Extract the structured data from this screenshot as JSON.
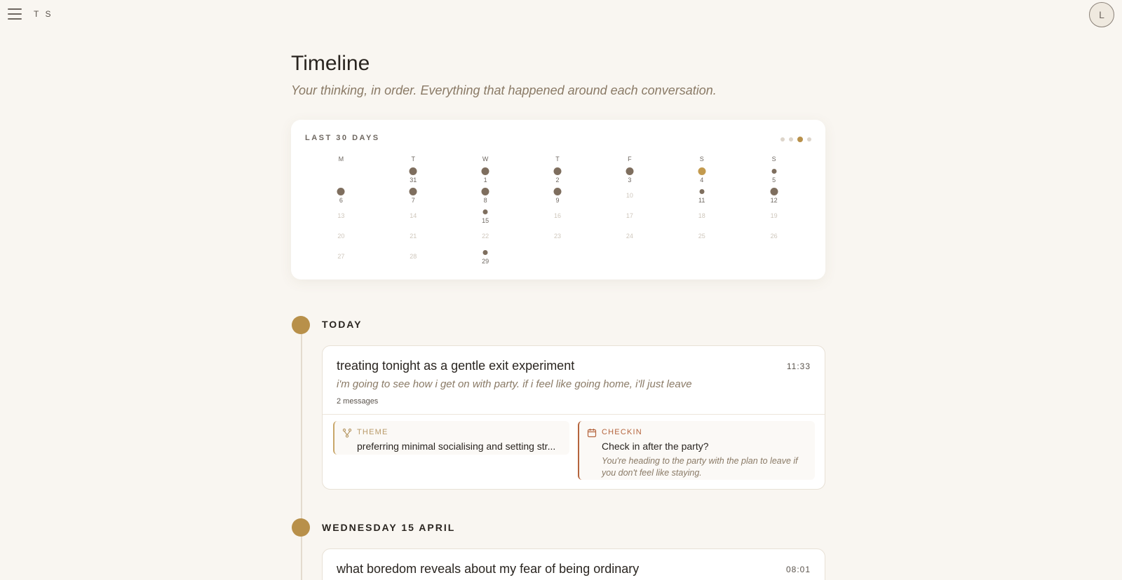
{
  "app": {
    "brand": "T S",
    "avatar_initial": "L"
  },
  "header": {
    "title": "Timeline",
    "subtitle": "Your thinking, in order. Everything that happened around each conversation."
  },
  "calendar": {
    "label": "LAST 30 DAYS",
    "weekdays": [
      "M",
      "T",
      "W",
      "T",
      "F",
      "S",
      "S"
    ],
    "weeks": [
      [
        null,
        {
          "day": "31",
          "dot": "big"
        },
        {
          "day": "1",
          "dot": "big"
        },
        {
          "day": "2",
          "dot": "big"
        },
        {
          "day": "3",
          "dot": "big"
        },
        {
          "day": "4",
          "dot": "gold"
        },
        {
          "day": "5",
          "dot": "small"
        }
      ],
      [
        {
          "day": "6",
          "dot": "big"
        },
        {
          "day": "7",
          "dot": "big"
        },
        {
          "day": "8",
          "dot": "big"
        },
        {
          "day": "9",
          "dot": "big"
        },
        {
          "day": "10",
          "dot": "none"
        },
        {
          "day": "11",
          "dot": "small"
        },
        {
          "day": "12",
          "dot": "big"
        }
      ],
      [
        {
          "day": "13",
          "dot": "none"
        },
        {
          "day": "14",
          "dot": "none"
        },
        {
          "day": "15",
          "dot": "small"
        },
        {
          "day": "16",
          "dot": "none"
        },
        {
          "day": "17",
          "dot": "none"
        },
        {
          "day": "18",
          "dot": "none"
        },
        {
          "day": "19",
          "dot": "none"
        }
      ],
      [
        {
          "day": "20",
          "dot": "none"
        },
        {
          "day": "21",
          "dot": "none"
        },
        {
          "day": "22",
          "dot": "none"
        },
        {
          "day": "23",
          "dot": "none"
        },
        {
          "day": "24",
          "dot": "none"
        },
        {
          "day": "25",
          "dot": "none"
        },
        {
          "day": "26",
          "dot": "none"
        }
      ],
      [
        {
          "day": "27",
          "dot": "none"
        },
        {
          "day": "28",
          "dot": "none"
        },
        {
          "day": "29",
          "dot": "small"
        },
        null,
        null,
        null,
        null
      ]
    ],
    "pager_active_index": 2,
    "pager_count": 4
  },
  "timeline": {
    "today": {
      "label": "TODAY",
      "entry": {
        "title": "treating tonight as a gentle exit experiment",
        "time": "11:33",
        "snippet": "i'm going to see how i get on with party. if i feel like going home, i'll just leave",
        "count": "2 messages",
        "theme": {
          "kind": "THEME",
          "title": "preferring minimal socialising and setting str..."
        },
        "checkin": {
          "kind": "CHECKIN",
          "title": "Check in after the party?",
          "desc": "You're heading to the party with the plan to leave if you don't feel like staying."
        }
      }
    },
    "wed": {
      "label": "WEDNESDAY 15 APRIL",
      "entry": {
        "title": "what boredom reveals about my fear of being ordinary",
        "time": "08:01"
      }
    }
  },
  "colors": {
    "accent": "#b8904a",
    "checkin": "#b5653e",
    "background": "#f9f6f1"
  }
}
